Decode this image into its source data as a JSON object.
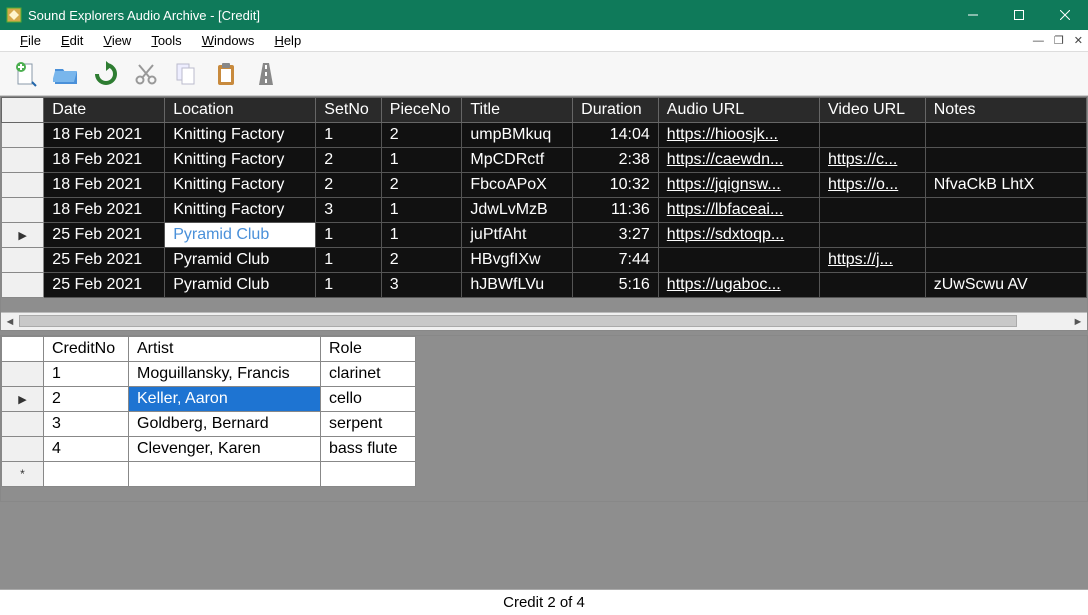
{
  "titlebar": {
    "title": "Sound Explorers Audio Archive - [Credit]"
  },
  "menu": {
    "file": "File",
    "edit": "Edit",
    "view": "View",
    "tools": "Tools",
    "windows": "Windows",
    "help": "Help"
  },
  "toolbar": {
    "icons": [
      "add-doc",
      "open-folder",
      "refresh",
      "cut",
      "copy",
      "paste",
      "delete"
    ]
  },
  "topgrid": {
    "cols": [
      "Date",
      "Location",
      "SetNo",
      "PieceNo",
      "Title",
      "Duration",
      "Audio URL",
      "Video URL",
      "Notes"
    ],
    "rows": [
      {
        "date": "18 Feb 2021",
        "loc": "Knitting Factory",
        "set": "1",
        "piece": "2",
        "title": "umpBMkuq",
        "dur": "14:04",
        "au": "https://hioosjk...",
        "vu": "",
        "notes": ""
      },
      {
        "date": "18 Feb 2021",
        "loc": "Knitting Factory",
        "set": "2",
        "piece": "1",
        "title": "MpCDRctf",
        "dur": "2:38",
        "au": "https://caewdn...",
        "vu": "https://c...",
        "notes": ""
      },
      {
        "date": "18 Feb 2021",
        "loc": "Knitting Factory",
        "set": "2",
        "piece": "2",
        "title": "FbcoAPoX",
        "dur": "10:32",
        "au": "https://jqignsw...",
        "vu": "https://o...",
        "notes": "NfvaCkB LhtX"
      },
      {
        "date": "18 Feb 2021",
        "loc": "Knitting Factory",
        "set": "3",
        "piece": "1",
        "title": "JdwLvMzB",
        "dur": "11:36",
        "au": "https://lbfaceai...",
        "vu": "",
        "notes": ""
      },
      {
        "date": "25 Feb 2021",
        "loc": "Pyramid Club",
        "set": "1",
        "piece": "1",
        "title": "juPtfAht",
        "dur": "3:27",
        "au": "https://sdxtoqp...",
        "vu": "",
        "notes": ""
      },
      {
        "date": "25 Feb 2021",
        "loc": "Pyramid Club",
        "set": "1",
        "piece": "2",
        "title": "HBvgfIXw",
        "dur": "7:44",
        "au": "",
        "vu": "https://j...",
        "notes": ""
      },
      {
        "date": "25 Feb 2021",
        "loc": "Pyramid Club",
        "set": "1",
        "piece": "3",
        "title": "hJBWfLVu",
        "dur": "5:16",
        "au": "https://ugaboc...",
        "vu": "",
        "notes": "zUwScwu AV"
      }
    ],
    "selected_row": 4
  },
  "bottomgrid": {
    "cols": [
      "CreditNo",
      "Artist",
      "Role"
    ],
    "rows": [
      {
        "cn": "1",
        "artist": "Moguillansky, Francis",
        "role": "clarinet"
      },
      {
        "cn": "2",
        "artist": "Keller, Aaron",
        "role": "cello"
      },
      {
        "cn": "3",
        "artist": "Goldberg, Bernard",
        "role": "serpent"
      },
      {
        "cn": "4",
        "artist": "Clevenger, Karen",
        "role": "bass flute"
      }
    ],
    "selected_row": 1,
    "selected_col": "artist"
  },
  "status": {
    "text": "Credit 2 of 4"
  }
}
